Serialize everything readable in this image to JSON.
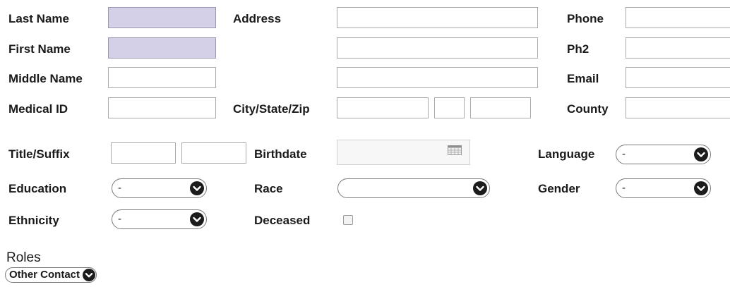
{
  "labels": {
    "last_name": "Last Name",
    "first_name": "First Name",
    "middle_name": "Middle Name",
    "medical_id": "Medical ID",
    "address": "Address",
    "city_state_zip": "City/State/Zip",
    "phone": "Phone",
    "ph2": "Ph2",
    "email": "Email",
    "county": "County",
    "title_suffix": "Title/Suffix",
    "birthdate": "Birthdate",
    "language": "Language",
    "education": "Education",
    "race": "Race",
    "gender": "Gender",
    "ethnicity": "Ethnicity",
    "deceased": "Deceased"
  },
  "fields": {
    "last_name": "",
    "first_name": "",
    "middle_name": "",
    "medical_id": "",
    "address1": "",
    "address2": "",
    "address3": "",
    "city": "",
    "state": "",
    "zip": "",
    "phone": "",
    "ph2": "",
    "email": "",
    "county": "",
    "title": "",
    "suffix": "",
    "birthdate": ""
  },
  "selects": {
    "language": "-",
    "education": "-",
    "race": "",
    "gender": "-",
    "ethnicity": "-"
  },
  "deceased_checked": false,
  "roles": {
    "title": "Roles",
    "selected": "Other Contact"
  },
  "colors": {
    "required_field_bg": "#d4d0e8",
    "chevron_bg": "#1c1c1c"
  },
  "icons": {
    "calendar": "calendar-icon",
    "chevron": "chevron-down-icon"
  }
}
